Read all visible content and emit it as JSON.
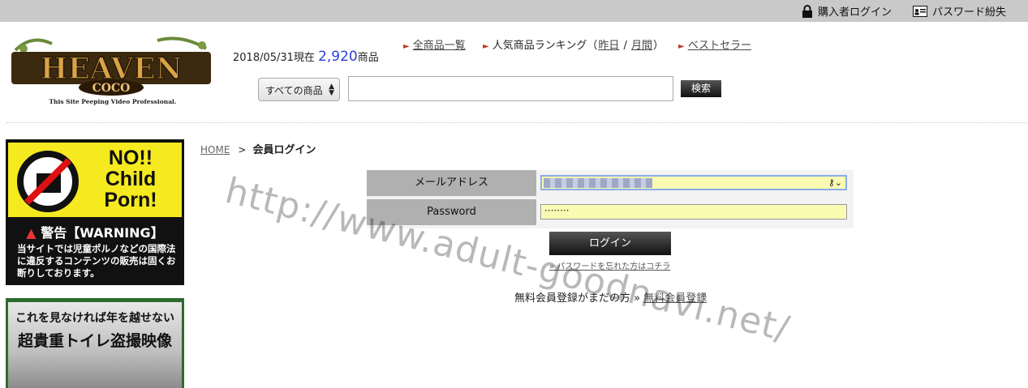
{
  "topbar": {
    "buyer_login": "購入者ログイン",
    "password_lost": "パスワード紛失",
    "icons": [
      "lock-icon",
      "id-card-icon"
    ]
  },
  "logo": {
    "main": "HEAVEN",
    "sub": "COCO",
    "tagline": "This Site Peeping Video Professional."
  },
  "stats": {
    "date_prefix": "2018/05/31現在",
    "count": "2,920",
    "suffix": "商品"
  },
  "nav": {
    "all_products": "全商品一覧",
    "ranking_label": "人気商品ランキング（",
    "yesterday": "昨日",
    "slash": " / ",
    "monthly": "月間",
    "ranking_close": "）",
    "bestseller": "ベストセラー"
  },
  "search": {
    "category": "すべての商品",
    "button": "検索"
  },
  "banners": {
    "no_child_porn": "NO!! Child Porn!",
    "warning_title": "警告【WARNING】",
    "warning_text": "当サイトでは児童ポルノなどの国際法に違反するコンテンツの販売は固くお断りしております。",
    "promo_line1": "これを見なければ年を越せない",
    "promo_line2": "超貴重トイレ盗撮映像"
  },
  "breadcrumb": {
    "home": "HOME",
    "sep": ">",
    "current": "会員ログイン"
  },
  "form": {
    "email_label": "メールアドレス",
    "password_label": "Password",
    "password_value": "········",
    "login_button": "ログイン",
    "forgot_link": "» パスワードを忘れた方はコチラ"
  },
  "register": {
    "text": "無料会員登録がまだの方 »",
    "link": "無料会員登録"
  },
  "watermark": "http://www.adult-goodnavi.net/",
  "colors": {
    "topbar": "#c9c9c9",
    "count_blue": "#2b3fd6",
    "arrow_red": "#c0392b",
    "input_yellow": "#fafab3",
    "banner_yellow": "#f5ea20"
  }
}
